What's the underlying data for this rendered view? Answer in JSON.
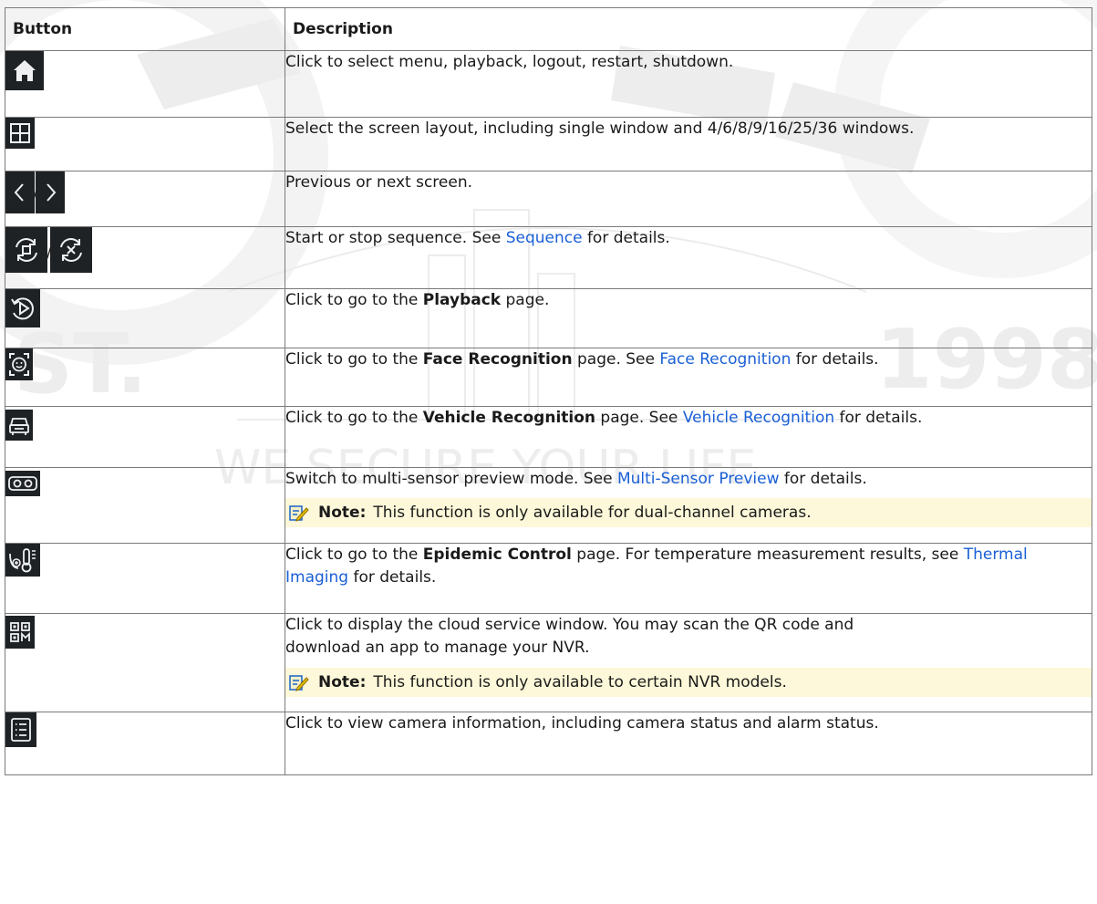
{
  "headers": {
    "button": "Button",
    "description": "Description"
  },
  "rows": [
    {
      "icon": "home-icon",
      "desc_text": "Click to select menu, playback, logout, restart, shutdown."
    },
    {
      "icon": "screen-layout-icon",
      "desc_text": "Select the screen layout, including single window and 4/6/8/9/16/25/36 windows."
    },
    {
      "icon": "previous-next-icons",
      "separator": "/",
      "desc_text": "Previous or next screen."
    },
    {
      "icon": "sequence-start-stop-icons",
      "separator": "/",
      "desc_pre": "Start or stop sequence. See ",
      "desc_link": "Sequence",
      "desc_post": " for details."
    },
    {
      "icon": "playback-icon",
      "desc_pre": "Click to go to the ",
      "desc_bold": "Playback",
      "desc_post": " page."
    },
    {
      "icon": "face-recognition-icon",
      "desc_pre": "Click to go to the ",
      "desc_bold": "Face Recognition",
      "desc_mid": " page. See ",
      "desc_link": "Face Recognition",
      "desc_post": " for details."
    },
    {
      "icon": "vehicle-recognition-icon",
      "desc_pre": "Click to go to the ",
      "desc_bold": "Vehicle Recognition",
      "desc_mid": " page. See ",
      "desc_link": "Vehicle Recognition",
      "desc_post": " for details."
    },
    {
      "icon": "multi-sensor-icon",
      "desc_pre": "Switch to multi-sensor preview mode. See ",
      "desc_link": "Multi-Sensor Preview",
      "desc_post": " for details.",
      "note_label": "Note:",
      "note_text": "This function is only available for dual-channel cameras."
    },
    {
      "icon": "epidemic-control-icon",
      "desc_pre": "Click to go to the ",
      "desc_bold": "Epidemic Control",
      "desc_mid": " page. For temperature measurement results, see ",
      "desc_link": "Thermal Imaging",
      "desc_post": " for details."
    },
    {
      "icon": "qr-code-icon",
      "desc_text": "Click to display the cloud service window. You may scan the QR code and download an app to manage your NVR.",
      "note_label": "Note:",
      "note_text": "This function is only available to certain NVR models."
    },
    {
      "icon": "camera-info-list-icon",
      "desc_text": "Click to view camera information, including camera status and alarm status."
    }
  ],
  "watermark": {
    "year": "1998",
    "slogan": "WE SECURE YOUR LIFE",
    "left_text": "ST."
  },
  "colors": {
    "link": "#1a5fd6",
    "note_bg": "#fdf8d9",
    "icon_bg": "#1f2225"
  }
}
